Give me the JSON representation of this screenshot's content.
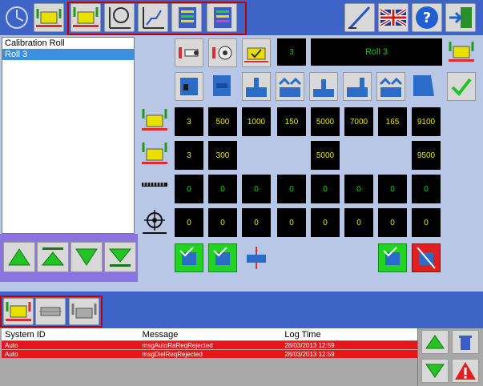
{
  "rolls": {
    "items": [
      "Calibration Roll",
      "Roll 3"
    ],
    "selected_index": 1
  },
  "header": {
    "step_value": "3",
    "roll_name": "Roll 3"
  },
  "rows": {
    "row1": [
      "3",
      "500",
      "1000",
      "150",
      "5000",
      "7000",
      "165",
      "9100"
    ],
    "row2": [
      "3",
      "300",
      "",
      "",
      "5000",
      "",
      "",
      "9500"
    ],
    "row3": [
      "0",
      "0",
      "0",
      "0",
      "0",
      "0",
      "0",
      "0"
    ],
    "row4": [
      "0",
      "0",
      "0",
      "0",
      "0",
      "0",
      "0",
      "0"
    ]
  },
  "log": {
    "headers": [
      "System ID",
      "Message",
      "Log Time"
    ],
    "rows": [
      {
        "system": "Auto",
        "message": "msgAutoRaReqRejected",
        "time": "28/03/2013 12:59"
      },
      {
        "system": "Auto",
        "message": "msgDielReqRejected",
        "time": "28/03/2013 12:59"
      }
    ]
  },
  "colors": {
    "toolbar": "#3e64c8",
    "panel": "#b9c7e6",
    "cell_bg": "#000000",
    "value_yellow": "#e8e000",
    "value_green": "#00d000",
    "alert_row": "#e41818",
    "frame_red": "#c00000"
  },
  "icons": {
    "topbar": [
      "clock-icon",
      "roll-transfer-icon",
      "roll-load-icon",
      "radius-measure-icon",
      "profile-measure-icon",
      "sequence-icon",
      "sequence-edit-icon",
      "pen-edit-icon",
      "uk-flag-icon",
      "help-icon",
      "exit-icon"
    ]
  }
}
